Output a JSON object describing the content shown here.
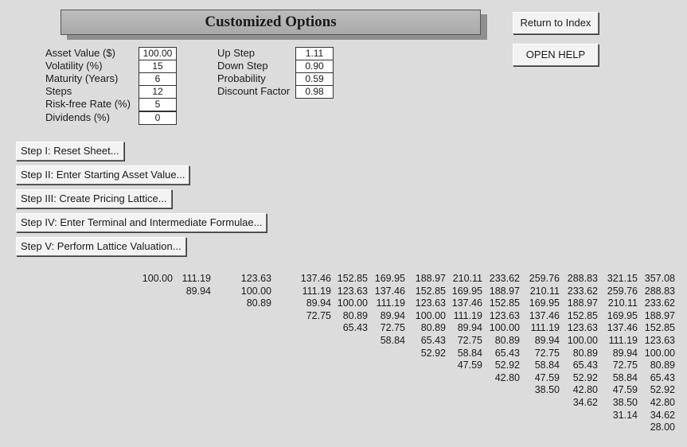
{
  "title": "Customized Options",
  "buttons": {
    "return_index": "Return to Index",
    "open_help": "OPEN HELP"
  },
  "inputs": [
    {
      "label": "Asset Value ($)",
      "value": "100.00"
    },
    {
      "label": "Volatility (%)",
      "value": "15"
    },
    {
      "label": "Maturity (Years)",
      "value": "6"
    },
    {
      "label": "Steps",
      "value": "12"
    },
    {
      "label": "Risk-free Rate (%)",
      "value": "5"
    },
    {
      "label": "Dividends (%)",
      "value": "0"
    }
  ],
  "outputs": [
    {
      "label": "Up Step",
      "value": "1.11"
    },
    {
      "label": "Down Step",
      "value": "0.90"
    },
    {
      "label": "Probability",
      "value": "0.59"
    },
    {
      "label": "Discount Factor",
      "value": "0.98"
    }
  ],
  "steps": [
    "Step I: Reset Sheet...",
    "Step II: Enter Starting Asset Value...",
    "Step III: Create Pricing Lattice...",
    "Step IV: Enter Terminal and Intermediate Formulae...",
    "Step V: Perform Lattice Valuation..."
  ],
  "lattice": [
    [
      "100.00"
    ],
    [
      "111.19",
      "89.94"
    ],
    [
      "123.63",
      "100.00",
      "80.89"
    ],
    [
      "137.46",
      "111.19",
      "89.94",
      "72.75"
    ],
    [
      "152.85",
      "123.63",
      "100.00",
      "80.89",
      "65.43"
    ],
    [
      "169.95",
      "137.46",
      "111.19",
      "89.94",
      "72.75",
      "58.84"
    ],
    [
      "188.97",
      "152.85",
      "123.63",
      "100.00",
      "80.89",
      "65.43",
      "52.92"
    ],
    [
      "210.11",
      "169.95",
      "137.46",
      "111.19",
      "89.94",
      "72.75",
      "58.84",
      "47.59"
    ],
    [
      "233.62",
      "188.97",
      "152.85",
      "123.63",
      "100.00",
      "80.89",
      "65.43",
      "52.92",
      "42.80"
    ],
    [
      "259.76",
      "210.11",
      "169.95",
      "137.46",
      "111.19",
      "89.94",
      "72.75",
      "58.84",
      "47.59",
      "38.50"
    ],
    [
      "288.83",
      "233.62",
      "188.97",
      "152.85",
      "123.63",
      "100.00",
      "80.89",
      "65.43",
      "52.92",
      "42.80",
      "34.62"
    ],
    [
      "321.15",
      "259.76",
      "210.11",
      "169.95",
      "137.46",
      "111.19",
      "89.94",
      "72.75",
      "58.84",
      "47.59",
      "38.50",
      "31.14"
    ],
    [
      "357.08",
      "288.83",
      "233.62",
      "188.97",
      "152.85",
      "123.63",
      "100.00",
      "80.89",
      "65.43",
      "52.92",
      "42.80",
      "34.62",
      "28.00"
    ]
  ]
}
